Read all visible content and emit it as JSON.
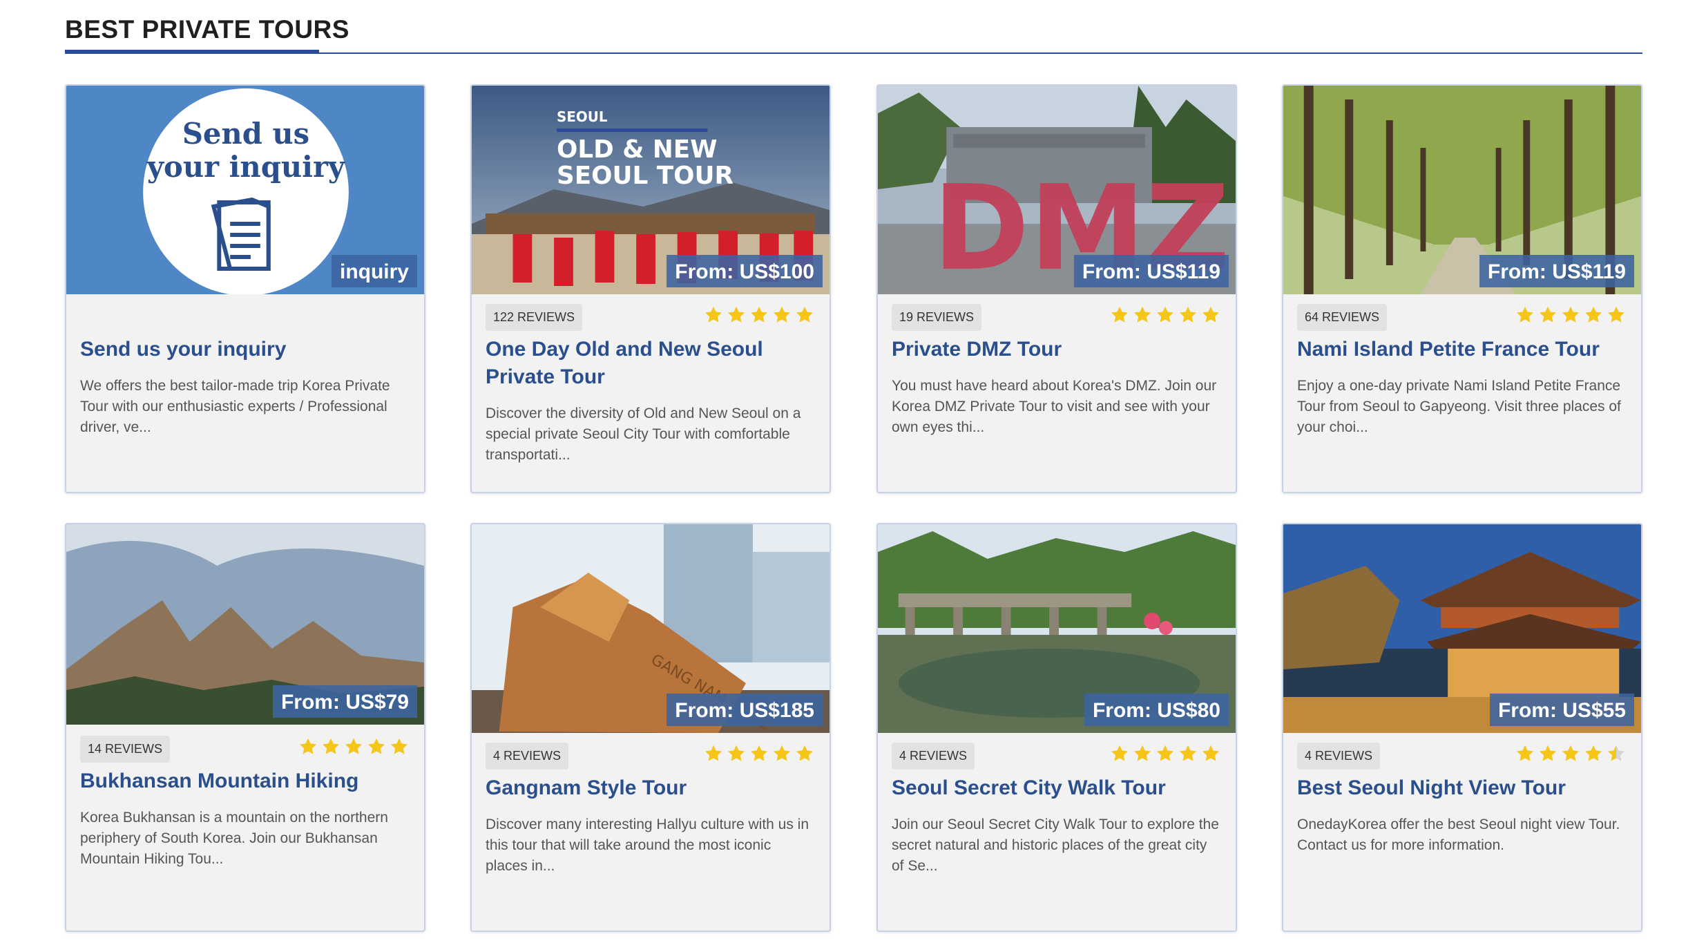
{
  "section": {
    "title": "BEST PRIVATE TOURS"
  },
  "colors": {
    "accent": "#2b4a9a",
    "title_link": "#2a4f8c",
    "star": "#f5c518",
    "price_bg": "#3c64a0"
  },
  "cards": [
    {
      "title": "Send us your inquiry",
      "price": "inquiry",
      "reviews": "",
      "rating": 0,
      "description": "We offers the best tailor-made trip Korea Private Tour with our enthusiastic experts / Professional driver, ve...",
      "image_text": {
        "line1": "Send us",
        "line2": "your inquiry"
      }
    },
    {
      "title": "One Day Old and New Seoul Private Tour",
      "price": "From: US$100",
      "reviews": "122 REVIEWS",
      "rating": 5,
      "description": "Discover the diversity of Old and New Seoul on a special private Seoul City Tour with comfortable transportati...",
      "image_text": {
        "kicker": "SEOUL",
        "line1": "OLD & NEW",
        "line2": "SEOUL TOUR"
      }
    },
    {
      "title": "Private DMZ Tour",
      "price": "From: US$119",
      "reviews": "19 REVIEWS",
      "rating": 5,
      "description": "You must have heard about Korea's DMZ. Join our Korea DMZ Private Tour to visit and see with your own eyes thi...",
      "image_text": {
        "sign": "DMZ"
      }
    },
    {
      "title": "Nami Island Petite France Tour",
      "price": "From: US$119",
      "reviews": "64 REVIEWS",
      "rating": 5,
      "description": "Enjoy a one-day private Nami Island Petite France Tour from Seoul to Gapyeong. Visit three places of your choi..."
    },
    {
      "title": "Bukhansan Mountain Hiking",
      "price": "From: US$79",
      "reviews": "14 REVIEWS",
      "rating": 5,
      "description": "Korea Bukhansan is a mountain on the northern periphery of South Korea. Join our Bukhansan Mountain Hiking Tou..."
    },
    {
      "title": "Gangnam Style Tour",
      "price": "From: US$185",
      "reviews": "4 REVIEWS",
      "rating": 5,
      "description": "Discover many interesting Hallyu culture with us in this tour that will take around the most iconic places in...",
      "image_text": {
        "engraving": "GANG NAM STYLE"
      }
    },
    {
      "title": "Seoul Secret City Walk Tour",
      "price": "From: US$80",
      "reviews": "4 REVIEWS",
      "rating": 5,
      "description": "Join our Seoul Secret City Walk Tour to explore the secret natural and historic places of the great city of Se..."
    },
    {
      "title": "Best Seoul Night View Tour",
      "price": "From: US$55",
      "reviews": "4 REVIEWS",
      "rating": 4.5,
      "description": "OnedayKorea offer the best Seoul night view Tour. Contact us for more information."
    }
  ]
}
